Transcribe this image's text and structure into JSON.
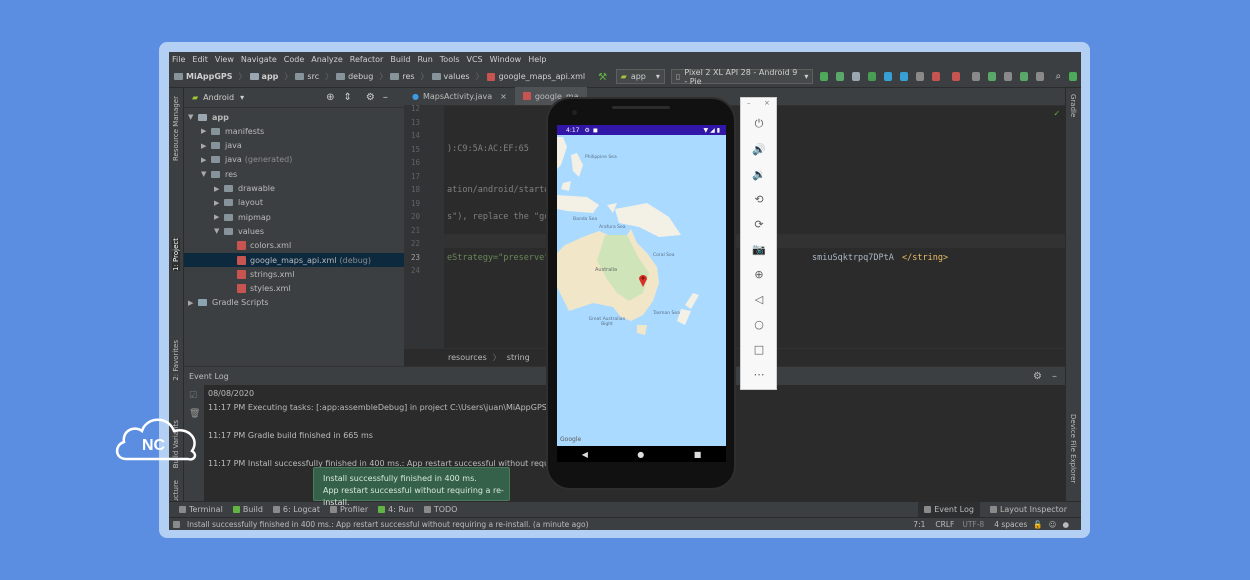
{
  "menu": [
    "File",
    "Edit",
    "View",
    "Navigate",
    "Code",
    "Analyze",
    "Refactor",
    "Build",
    "Run",
    "Tools",
    "VCS",
    "Window",
    "Help"
  ],
  "breadcrumb": [
    "MiAppGPS",
    "app",
    "src",
    "debug",
    "res",
    "values",
    "google_maps_api.xml"
  ],
  "toolbar": {
    "module": "app",
    "device": "Pixel 2 XL API 28 - Android 9 - Pie"
  },
  "left_tabs": {
    "resource_manager": "Resource Manager",
    "project": "1: Project",
    "favorites": "2: Favorites",
    "build_variants": "Build Variants",
    "structure": "7: Structure"
  },
  "right_tabs": {
    "gradle": "Gradle",
    "device_file_explorer": "Device File Explorer"
  },
  "project": {
    "view": "Android",
    "tree": [
      {
        "label": "app",
        "indent": 0,
        "open": true,
        "kind": "module",
        "extra": ""
      },
      {
        "label": "manifests",
        "indent": 1,
        "open": false,
        "kind": "folder",
        "extra": ""
      },
      {
        "label": "java",
        "indent": 1,
        "open": false,
        "kind": "folder",
        "extra": ""
      },
      {
        "label": "java",
        "indent": 1,
        "open": false,
        "kind": "folder",
        "extra": "(generated)"
      },
      {
        "label": "res",
        "indent": 1,
        "open": true,
        "kind": "folder",
        "extra": ""
      },
      {
        "label": "drawable",
        "indent": 2,
        "open": false,
        "kind": "folder",
        "extra": ""
      },
      {
        "label": "layout",
        "indent": 2,
        "open": false,
        "kind": "folder",
        "extra": ""
      },
      {
        "label": "mipmap",
        "indent": 2,
        "open": false,
        "kind": "folder",
        "extra": ""
      },
      {
        "label": "values",
        "indent": 2,
        "open": true,
        "kind": "folder",
        "extra": ""
      },
      {
        "label": "colors.xml",
        "indent": 3,
        "open": false,
        "kind": "xml",
        "extra": ""
      },
      {
        "label": "google_maps_api.xml",
        "indent": 3,
        "open": false,
        "kind": "xml",
        "extra": "(debug)",
        "selected": true
      },
      {
        "label": "strings.xml",
        "indent": 3,
        "open": false,
        "kind": "xml",
        "extra": ""
      },
      {
        "label": "styles.xml",
        "indent": 3,
        "open": false,
        "kind": "xml",
        "extra": ""
      },
      {
        "label": "Gradle Scripts",
        "indent": 0,
        "open": false,
        "kind": "gradle",
        "extra": ""
      }
    ]
  },
  "editor": {
    "tabs": [
      "MapsActivity.java",
      "google_ma"
    ],
    "line_numbers": [
      "12",
      "13",
      "14",
      "15",
      "16",
      "17",
      "18",
      "19",
      "20",
      "21",
      "22",
      "23",
      "24"
    ],
    "code": {
      "l15": "):C9:5A:AC:EF:65",
      "l18": "ation/android/start#",
      "l20": "s\"), replace the \"go",
      "l23a": "eStrategy=\"preserve\"",
      "l23b": "smiuSqktrpq7DPtA",
      "l23c": "</string>"
    },
    "breadcrumb": [
      "resources",
      "string"
    ]
  },
  "event_log": {
    "title": "Event Log",
    "lines": [
      "08/08/2020",
      "11:17 PM Executing tasks: [:app:assembleDebug] in project C:\\Users\\juan\\MiAppGPS",
      "11:17 PM Gradle build finished in 665 ms",
      "11:17 PM Install successfully finished in 400 ms.: App restart successful without requiring a re-install."
    ]
  },
  "popup": {
    "line1": "Install successfully finished in 400 ms.",
    "line2": "App restart successful without requiring a re-install."
  },
  "bottom_tabs": [
    "Terminal",
    "Build",
    "6: Logcat",
    "Profiler",
    "4: Run",
    "TODO"
  ],
  "bottom_right_tabs": [
    "Event Log",
    "Layout Inspector"
  ],
  "status": {
    "message": "Install successfully finished in 400 ms.: App restart successful without requiring a re-install. (a minute ago)",
    "position": "7:1",
    "line_sep": "CRLF",
    "encoding": "UTF-8",
    "indent": "4 spaces"
  },
  "phone": {
    "time": "4:17",
    "map_labels": [
      "Philippine Sea",
      "Banda Sea",
      "Arafura Sea",
      "Coral Sea",
      "Australia",
      "Great Australian Bight",
      "Tasman Sea"
    ],
    "google": "Google"
  },
  "logo_text": "NC",
  "colors": {
    "accent": "#3116a7",
    "marker": "#d93025",
    "background": "#5b8ee0"
  }
}
